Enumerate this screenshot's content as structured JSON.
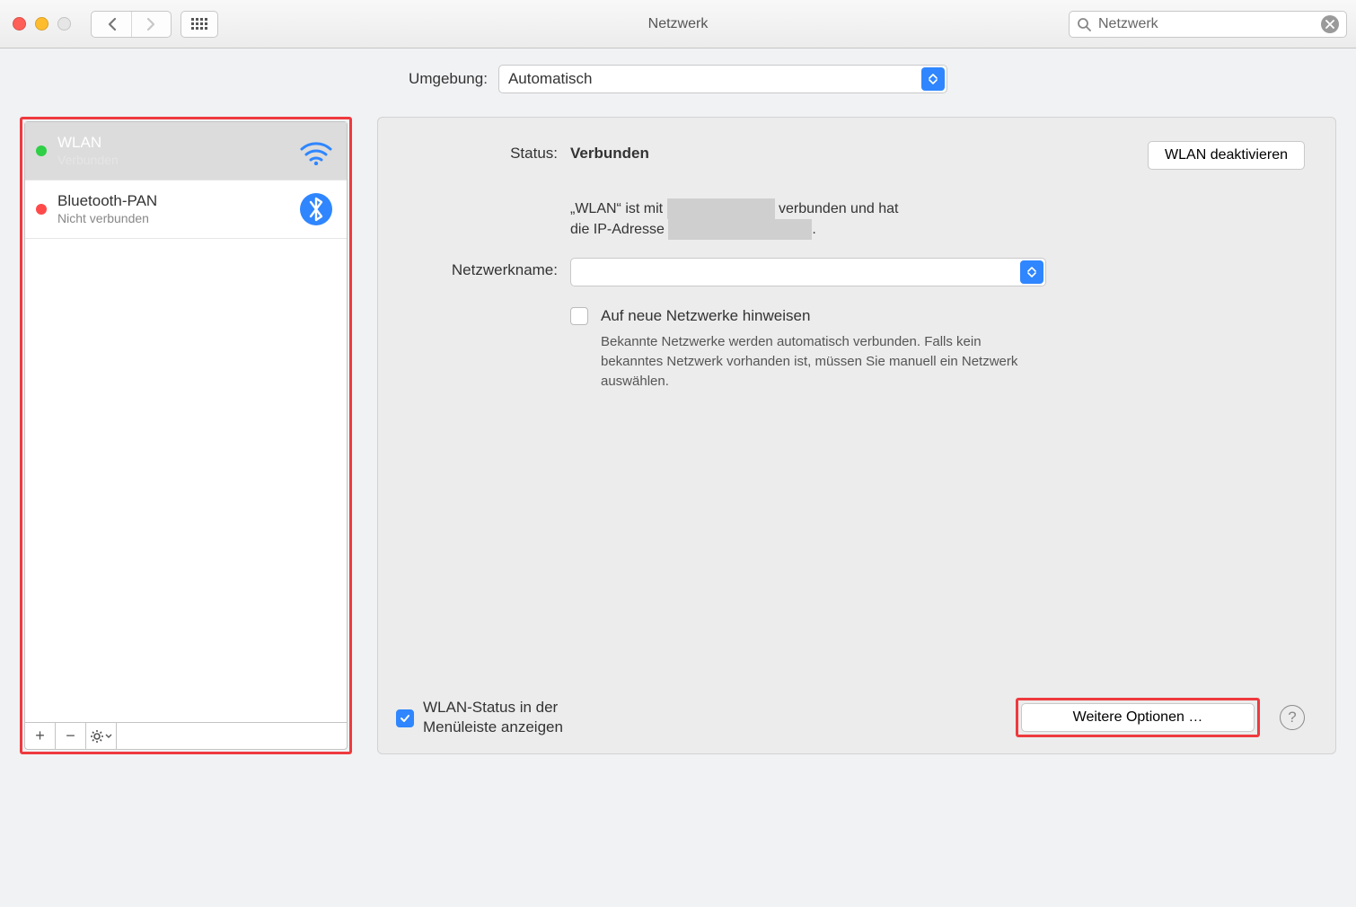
{
  "window": {
    "title": "Netzwerk",
    "search_value": "Netzwerk"
  },
  "location": {
    "label": "Umgebung:",
    "value": "Automatisch"
  },
  "sidebar": {
    "items": [
      {
        "name": "WLAN",
        "status": "Verbunden",
        "icon": "wifi",
        "dot": "green",
        "selected": true
      },
      {
        "name": "Bluetooth-PAN",
        "status": "Nicht verbunden",
        "icon": "bluetooth",
        "dot": "red",
        "selected": false
      }
    ]
  },
  "details": {
    "status_label": "Status:",
    "status_value": "Verbunden",
    "deactivate_label": "WLAN deaktivieren",
    "status_text_1a": "„WLAN“ ist mit ",
    "status_text_1b": " verbunden und hat",
    "status_text_2a": "die IP-Adresse ",
    "status_text_2b": ".",
    "network_label": "Netzwerkname:",
    "network_value": " ",
    "ask_new_label": "Auf neue Netzwerke hinweisen",
    "ask_new_hint": "Bekannte Netzwerke werden automatisch verbunden. Falls kein bekanntes Netzwerk vorhanden ist, müssen Sie manuell ein Netzwerk auswählen.",
    "menubar_checkbox_label": "WLAN-Status in der Menüleiste anzeigen",
    "advanced_label": "Weitere Optionen …"
  }
}
